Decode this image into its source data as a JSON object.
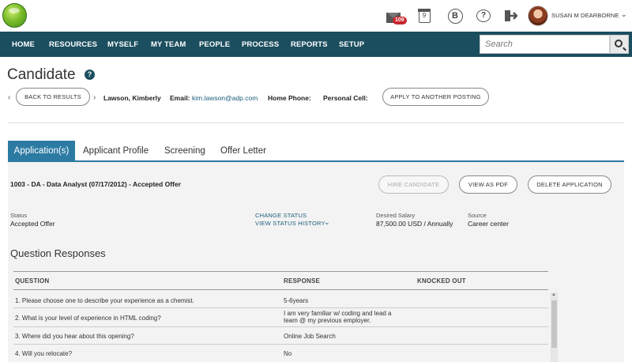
{
  "header": {
    "user_name": "SUSAN M DEARBORNE",
    "mail_badge": "109",
    "calendar_glyph": "9",
    "b_glyph": "B",
    "help_glyph": "?",
    "icons": [
      "logo",
      "mail-icon",
      "calendar-icon",
      "b-icon",
      "help-bubble-icon",
      "exit-icon",
      "avatar",
      "chevron-down-icon"
    ]
  },
  "nav": {
    "items": [
      "HOME",
      "RESOURCES",
      "MYSELF",
      "MY TEAM",
      "PEOPLE",
      "PROCESS",
      "REPORTS",
      "SETUP"
    ],
    "search_placeholder": "Search",
    "bar_color": "#1b4e5f"
  },
  "page": {
    "title": "Candidate",
    "help_icon": "?"
  },
  "candidate_bar": {
    "back_label": "BACK TO RESULTS",
    "name": "Lawson, Kimberly",
    "email_label": "Email:",
    "email_value": "kim.lawson@adp.com",
    "home_phone_label": "Home Phone:",
    "cell_label": "Personal Cell:",
    "apply_label": "APPLY TO ANOTHER POSTING"
  },
  "tabs": {
    "items": [
      "Application(s)",
      "Applicant Profile",
      "Screening",
      "Offer Letter"
    ],
    "active_color": "#2c7ba3"
  },
  "application": {
    "title": "1003 - DA - Data Analyst (07/17/2012) - Accepted Offer",
    "hire_label": "HIRE CANDIDATE",
    "pdf_label": "VIEW AS PDF",
    "delete_label": "DELETE APPLICATION",
    "status_label": "Status",
    "status_value": "Accepted Offer",
    "change_status": "CHANGE STATUS",
    "view_history": "VIEW STATUS HISTORY",
    "salary_label": "Desired Salary",
    "salary_value": "87,500.00 USD / Annually",
    "source_label": "Source",
    "source_value": "Career center"
  },
  "questions": {
    "title": "Question Responses",
    "headers": [
      "QUESTION",
      "RESPONSE",
      "KNOCKED OUT"
    ],
    "rows": [
      {
        "question": "1. Please choose one to describe your experience as a chemist.",
        "response_1": "5-6years",
        "response_2": "",
        "knocked_out": ""
      },
      {
        "question": "2. What is your level of experience in HTML coding?",
        "response_1": "I am very familiar w/ coding and lead a",
        "response_2": "team @ my previous employer.",
        "knocked_out": ""
      },
      {
        "question": "3. Where did you hear about this opening?",
        "response_1": "Online Job Search",
        "response_2": "",
        "knocked_out": ""
      },
      {
        "question": "4. Will you relocate?",
        "response_1": "No",
        "response_2": "",
        "knocked_out": ""
      }
    ]
  }
}
